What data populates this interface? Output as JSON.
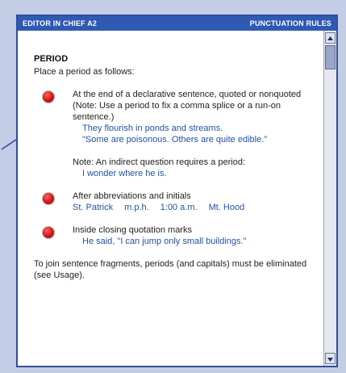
{
  "window": {
    "title_left": "Editor in Chief A2",
    "title_right": "Punctuation Rules"
  },
  "section": {
    "heading": "PERIOD",
    "intro": "Place a period as follows:"
  },
  "rules": [
    {
      "text": "At the end of a declarative sentence, quoted or nonquoted (Note: Use a period to fix a comma splice or a run-on sentence.)",
      "examples": [
        "They flourish in ponds and streams.",
        "\"Some are poisonous. Others are quite edible.\""
      ]
    }
  ],
  "note": {
    "text": "Note: An indirect question requires a period:",
    "example": "I wonder where he is."
  },
  "rule2": {
    "text": "After abbreviations and initials",
    "examples": [
      "St. Patrick",
      "m.p.h.",
      "1:00 a.m.",
      "Mt. Hood"
    ]
  },
  "rule3": {
    "text": "Inside closing quotation marks",
    "example": "He said, \"I can jump only small buildings.\""
  },
  "closing": "To join sentence fragments, periods (and capitals) must be eliminated (see Usage).",
  "colors": {
    "titlebar": "#2f59b3",
    "example_text": "#2550a8",
    "bullet": "#d21a1a",
    "background": "#c3cde6"
  },
  "icons": {
    "scroll_up": "triangle-up-icon",
    "scroll_down": "triangle-down-icon",
    "bullet": "red-dot-icon"
  }
}
